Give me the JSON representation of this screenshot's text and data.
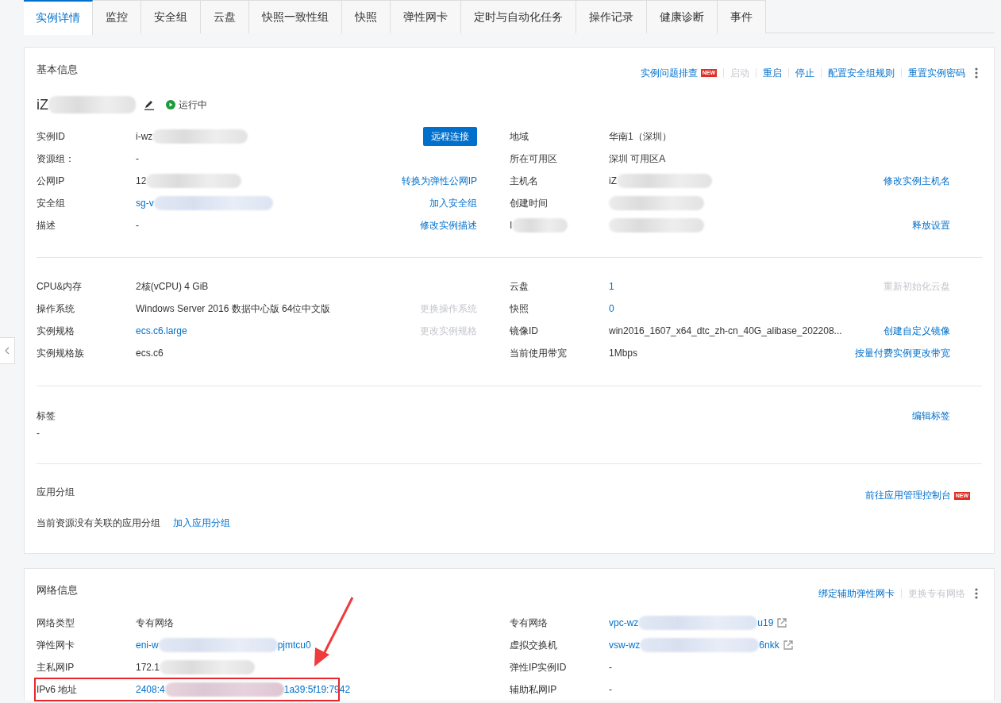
{
  "tabs": [
    {
      "label": "实例详情",
      "selected": true
    },
    {
      "label": "监控",
      "selected": false
    },
    {
      "label": "安全组",
      "selected": false
    },
    {
      "label": "云盘",
      "selected": false
    },
    {
      "label": "快照一致性组",
      "selected": false
    },
    {
      "label": "快照",
      "selected": false
    },
    {
      "label": "弹性网卡",
      "selected": false
    },
    {
      "label": "定时与自动化任务",
      "selected": false
    },
    {
      "label": "操作记录",
      "selected": false
    },
    {
      "label": "健康诊断",
      "selected": false
    },
    {
      "label": "事件",
      "selected": false
    }
  ],
  "basic_info": {
    "title": "基本信息",
    "actions": [
      {
        "label": "实例问题排查",
        "disabled": false,
        "badge": "NEW"
      },
      {
        "label": "启动",
        "disabled": true
      },
      {
        "label": "重启",
        "disabled": false
      },
      {
        "label": "停止",
        "disabled": false
      },
      {
        "label": "配置安全组规则",
        "disabled": false
      },
      {
        "label": "重置实例密码",
        "disabled": false
      }
    ],
    "instance_name": {
      "text": "iZ",
      "redacted": true
    },
    "status": {
      "label": "运行中"
    },
    "sections": [
      {
        "left": [
          {
            "label": "实例ID",
            "value": "i-wz",
            "kind": "text",
            "redacted": true,
            "action": {
              "label": "远程连接",
              "kind": "button",
              "disabled": false
            }
          },
          {
            "label": "资源组：",
            "value": "-",
            "kind": "text"
          },
          {
            "label": "公网IP",
            "value": "12",
            "kind": "text",
            "redacted": true,
            "action": {
              "label": "转换为弹性公网IP",
              "kind": "link",
              "disabled": false
            }
          },
          {
            "label": "安全组",
            "value": "sg-v",
            "kind": "link",
            "redacted": true,
            "action": {
              "label": "加入安全组",
              "kind": "link",
              "disabled": false
            }
          },
          {
            "label": "描述",
            "value": "-",
            "kind": "text",
            "action": {
              "label": "修改实例描述",
              "kind": "link",
              "disabled": false
            }
          }
        ],
        "right": [
          {
            "label": "地域",
            "value": "华南1（深圳）",
            "kind": "text"
          },
          {
            "label": "所在可用区",
            "value": "深圳 可用区A",
            "kind": "text"
          },
          {
            "label": "主机名",
            "value": "iZ",
            "kind": "text",
            "redacted": true,
            "action": {
              "label": "修改实例主机名",
              "kind": "link",
              "disabled": false
            }
          },
          {
            "label": "创建时间",
            "kind": "text",
            "redacted": true
          },
          {
            "label": "I",
            "label_redacted": true,
            "kind": "text",
            "redacted": true,
            "action": {
              "label": "释放设置",
              "kind": "link",
              "disabled": false
            }
          }
        ]
      },
      {
        "left": [
          {
            "label": "CPU&内存",
            "value": "2核(vCPU) 4 GiB",
            "kind": "text"
          },
          {
            "label": "操作系统",
            "value": "Windows Server 2016 数据中心版 64位中文版",
            "kind": "text",
            "action": {
              "label": "更换操作系统",
              "kind": "link",
              "disabled": true
            }
          },
          {
            "label": "实例规格",
            "value": "ecs.c6.large",
            "kind": "link",
            "action": {
              "label": "更改实例规格",
              "kind": "link",
              "disabled": true
            }
          },
          {
            "label": "实例规格族",
            "value": "ecs.c6",
            "kind": "text"
          }
        ],
        "right": [
          {
            "label": "云盘",
            "value": "1",
            "kind": "link",
            "action": {
              "label": "重新初始化云盘",
              "kind": "link",
              "disabled": true
            }
          },
          {
            "label": "快照",
            "value": "0",
            "kind": "link"
          },
          {
            "label": "镜像ID",
            "value": "win2016_1607_x64_dtc_zh-cn_40G_alibase_202208...",
            "kind": "text",
            "action": {
              "label": "创建自定义镜像",
              "kind": "link",
              "disabled": false
            }
          },
          {
            "label": "当前使用带宽",
            "value": "1Mbps",
            "kind": "text",
            "action": {
              "label": "按量付费实例更改带宽",
              "kind": "link",
              "disabled": false
            }
          }
        ]
      }
    ],
    "tags": {
      "title": "标签",
      "value": "-",
      "action": {
        "label": "编辑标签",
        "kind": "link",
        "disabled": false
      }
    },
    "app_group": {
      "title": "应用分组",
      "action": {
        "label": "前往应用管理控制台",
        "kind": "link",
        "disabled": false,
        "badge": "NEW"
      },
      "note": "当前资源没有关联的应用分组",
      "link": "加入应用分组"
    }
  },
  "network_info": {
    "title": "网络信息",
    "actions": [
      {
        "label": "绑定辅助弹性网卡",
        "disabled": false
      },
      {
        "label": "更换专有网络",
        "disabled": true
      }
    ],
    "left": [
      {
        "label": "网络类型",
        "value": "专有网络",
        "kind": "text"
      },
      {
        "label": "弹性网卡",
        "value": "eni-w",
        "value_end": "pjmtcu0",
        "kind": "link",
        "redacted": true
      },
      {
        "label": "主私网IP",
        "value": "172.1",
        "kind": "text",
        "redacted": true
      },
      {
        "label": "IPv6 地址",
        "value": "2408:4",
        "value_end": "1a39:5f19:7942",
        "kind": "link",
        "redacted": true,
        "highlighted": true
      }
    ],
    "right": [
      {
        "label": "专有网络",
        "value": "vpc-wz",
        "value_end": "u19",
        "kind": "link",
        "redacted": true,
        "external": true
      },
      {
        "label": "虚拟交换机",
        "value": "vsw-wz",
        "value_end": "6nkk",
        "kind": "link",
        "redacted": true,
        "external": true
      },
      {
        "label": "弹性IP实例ID",
        "value": "-",
        "kind": "text"
      },
      {
        "label": "辅助私网IP",
        "value": "-",
        "kind": "text"
      }
    ]
  }
}
